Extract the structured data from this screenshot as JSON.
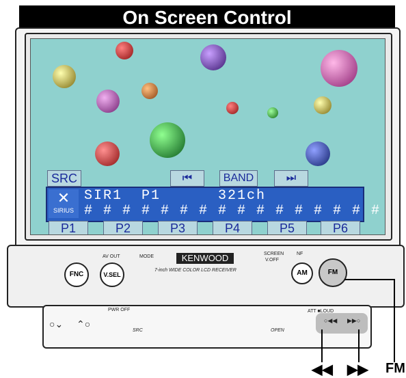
{
  "header": {
    "title": "On Screen Control"
  },
  "screen": {
    "src_label": "SRC",
    "band_label": "BAND",
    "prev_icon": "⏮",
    "next_icon": "⏭",
    "sirius_logo_text": "SIRIUS",
    "display_line1": "SIR1  P1      321ch",
    "display_line2": "# # # # # # # # # # # # # # # # #",
    "presets": [
      "P1",
      "P2",
      "P3",
      "P4",
      "P5",
      "P6"
    ]
  },
  "panel": {
    "fnc_label": "FNC",
    "vsel_label": "V.SEL",
    "av_out_label": "AV OUT",
    "mode_label": "MODE",
    "brand_label": "KENWOOD",
    "brand_desc": "7-inch WIDE COLOR LCD RECEIVER",
    "screen_label": "SCREEN",
    "v_off_label": "V.OFF",
    "nf_label": "NF",
    "am_label": "AM",
    "fm_label": "FM"
  },
  "lower_panel": {
    "pwr_off_label": "PWR OFF",
    "src_label": "SRC",
    "open_label": "OPEN",
    "att_loud_label": "ATT ■LOUD"
  },
  "callouts": {
    "prev": "◀◀",
    "next": "▶▶",
    "fm": "FM"
  }
}
